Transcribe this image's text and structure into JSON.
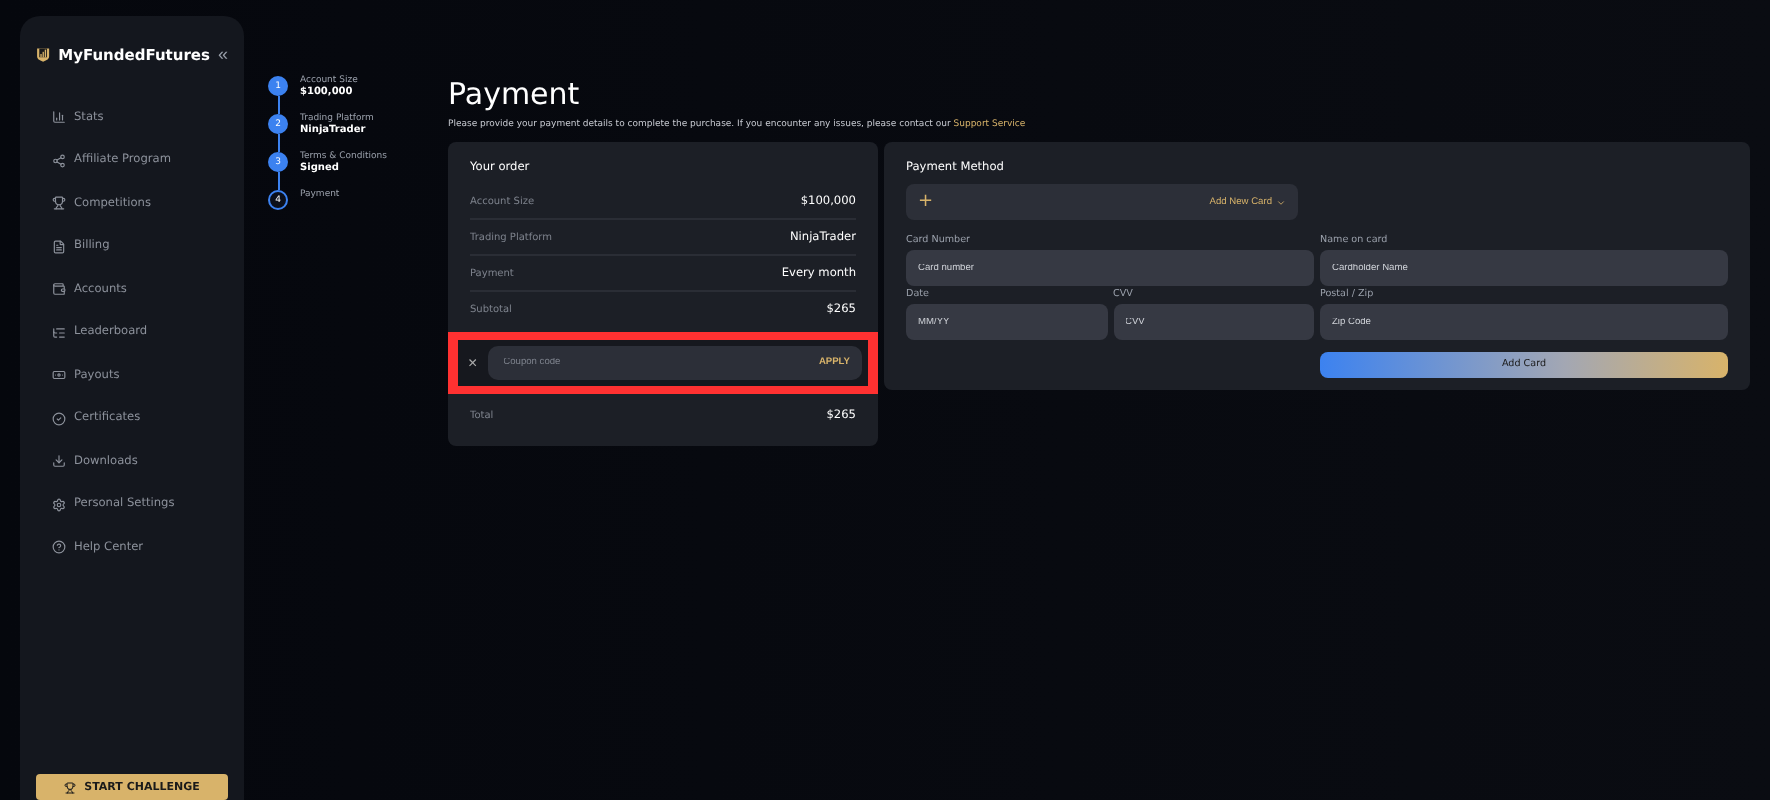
{
  "sidebar": {
    "brand": "MyFundedFutures",
    "collapse": "«",
    "items": [
      {
        "label": "Stats"
      },
      {
        "label": "Affiliate Program"
      },
      {
        "label": "Competitions"
      },
      {
        "label": "Billing"
      },
      {
        "label": "Accounts"
      },
      {
        "label": "Leaderboard"
      },
      {
        "label": "Payouts"
      },
      {
        "label": "Certificates"
      },
      {
        "label": "Downloads"
      },
      {
        "label": "Personal Settings"
      },
      {
        "label": "Help Center"
      }
    ],
    "cta": "START CHALLENGE"
  },
  "steps": [
    {
      "number": "1",
      "label": "Account Size",
      "value": "$100,000",
      "completed": true
    },
    {
      "number": "2",
      "label": "Trading Platform",
      "value": "NinjaTrader",
      "completed": true
    },
    {
      "number": "3",
      "label": "Terms & Conditions",
      "value": "Signed",
      "completed": true
    },
    {
      "number": "4",
      "label": "Payment",
      "completed": false
    }
  ],
  "title": "Payment",
  "intro": "Please provide your payment details to complete the purchase. If you encounter any issues, please contact our",
  "support_link": "Support Service",
  "order": {
    "heading": "Your order",
    "rows": [
      {
        "label": "Account Size",
        "value": "$100,000"
      },
      {
        "label": "Trading Platform",
        "value": "NinjaTrader"
      },
      {
        "label": "Payment",
        "value": "Every month"
      },
      {
        "label": "Subtotal",
        "value": "$265"
      }
    ],
    "coupon": {
      "placeholder": "Coupon code",
      "apply": "APPLY",
      "close": "×"
    },
    "total": {
      "label": "Total",
      "value": "$265"
    }
  },
  "payment": {
    "heading": "Payment Method",
    "add_new": "Add New Card",
    "add_icon": "+",
    "fields": [
      {
        "label": "Card Number",
        "placeholder": "Card number"
      },
      {
        "label": "Name on card",
        "placeholder": "Cardholder Name"
      },
      {
        "label": "Date",
        "placeholder": "MM/YY"
      },
      {
        "label": "CVV",
        "placeholder": "CVV"
      },
      {
        "label": "Postal / Zip",
        "placeholder": "Zip Code"
      }
    ],
    "submit": "Add Card"
  }
}
